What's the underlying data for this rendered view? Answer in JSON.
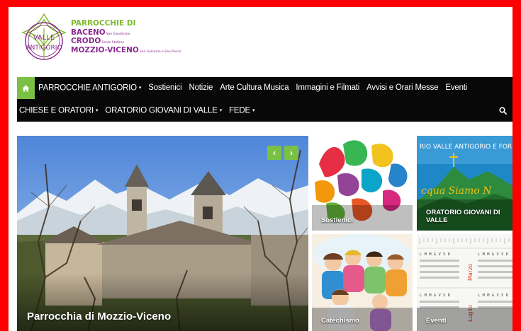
{
  "logo": {
    "emblem_top": "VALLE",
    "emblem_bottom": "ANTIGORIO",
    "title": "PARROCCHIE DI",
    "lines": [
      {
        "name": "BACENO",
        "saints": "San Gaudenzio"
      },
      {
        "name": "CRODO",
        "saints": "Santo Stefano"
      },
      {
        "name": "MOZZIO-VICENO",
        "saints": "San Giacomo e San Rocco"
      }
    ]
  },
  "nav": {
    "row1": [
      "PARROCCHIE ANTIGORIO",
      "Sostienici",
      "Notizie",
      "Arte Cultura Musica",
      "Immagini e Filmati",
      "Avvisi e Orari Messe",
      "Eventi"
    ],
    "row2": [
      "CHIESE E ORATORI",
      "ORATORIO GIOVANI DI VALLE",
      "FEDE"
    ],
    "caret": "▾",
    "home_icon": "home-icon",
    "search_icon": "search-icon"
  },
  "slider": {
    "caption": "Parrocchia di Mozzio-Viceno",
    "prev": "‹",
    "next": "›"
  },
  "tiles": {
    "sostienici": "Sostienici",
    "oratorio": "ORATORIO GIOVANI DI VALLE",
    "oratorio_banner": "RIO VALLE ANTIGORIO E FOR",
    "oratorio_script": "cqua Siamo N",
    "catechismo": "Catechismo",
    "eventi": "Eventi",
    "calendar_months": [
      "Marzo",
      "Luglio"
    ],
    "calendar_days": "L M M G V S D"
  },
  "colors": {
    "frame": "#ff0000",
    "accent": "#7ac143",
    "nav_bg": "#080808",
    "logo_green": "#7dbb2a",
    "logo_purple": "#8b2a8e"
  }
}
